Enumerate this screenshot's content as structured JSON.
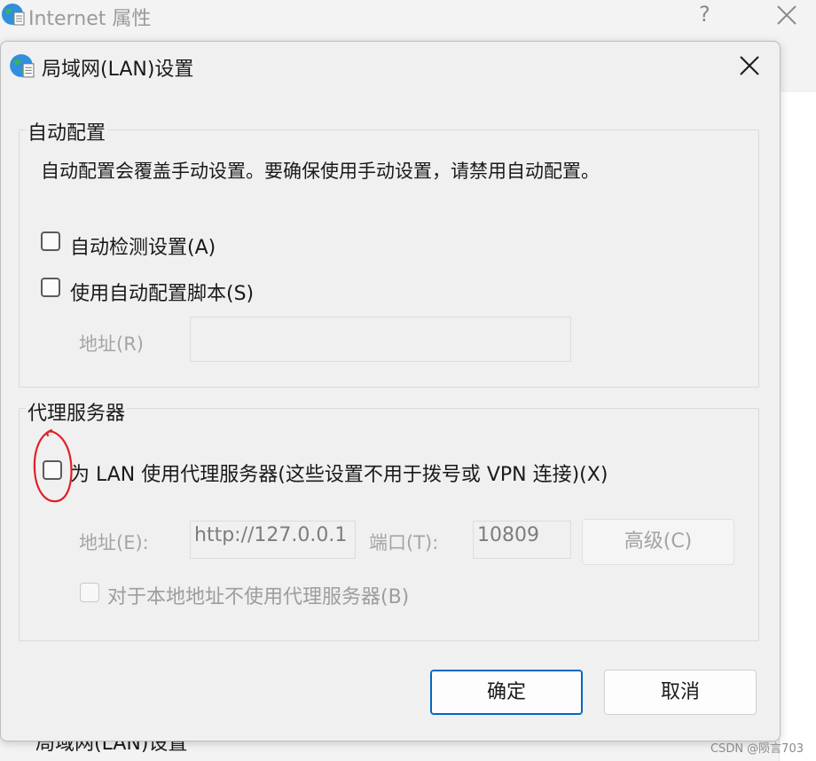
{
  "background_window": {
    "title": "Internet 属性",
    "help_label": "?",
    "bottom_text": "局域网(LAN)设置"
  },
  "dialog": {
    "title": "局域网(LAN)设置",
    "auto_config": {
      "group_title": "自动配置",
      "description": "自动配置会覆盖手动设置。要确保使用手动设置，请禁用自动配置。",
      "auto_detect": {
        "label": "自动检测设置(A)",
        "checked": false
      },
      "use_script": {
        "label": "使用自动配置脚本(S)",
        "checked": false
      },
      "address_label": "地址(R)",
      "address_value": ""
    },
    "proxy": {
      "group_title": "代理服务器",
      "use_proxy": {
        "label": "为 LAN 使用代理服务器(这些设置不用于拨号或 VPN 连接)(X)",
        "checked": false
      },
      "address_label": "地址(E):",
      "address_value": "http://127.0.0.1",
      "port_label": "端口(T):",
      "port_value": "10809",
      "advanced_label": "高级(C)",
      "bypass_local": {
        "label": "对于本地地址不使用代理服务器(B)",
        "checked": false
      }
    },
    "ok_label": "确定",
    "cancel_label": "取消"
  },
  "watermark": "CSDN @陨言703",
  "colors": {
    "dialog_bg": "#f0f0f0",
    "accent": "#0067c0",
    "annotation": "#e0202a",
    "disabled_text": "#a5a5a5"
  },
  "icons": [
    "globe-icon",
    "close-icon",
    "help-icon"
  ]
}
